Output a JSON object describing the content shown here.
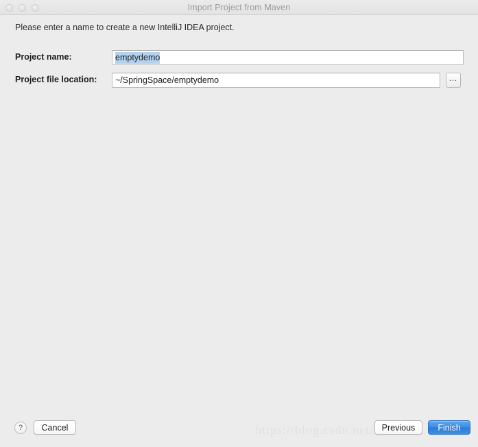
{
  "window": {
    "title": "Import Project from Maven",
    "traffic_lights": [
      "close",
      "minimize",
      "maximize"
    ]
  },
  "content": {
    "intro_text": "Please enter a name to create a new IntelliJ IDEA project."
  },
  "fields": {
    "project_name": {
      "label": "Project name:",
      "value": "emptydemo",
      "selected": true
    },
    "project_file_location": {
      "label": "Project file location:",
      "value": "~/SpringSpace/emptydemo",
      "browse_label": "..."
    }
  },
  "buttons": {
    "help": "?",
    "cancel": "Cancel",
    "previous": "Previous",
    "finish": "Finish"
  },
  "watermark": {
    "text": "https://blog.csdn.net/"
  },
  "colors": {
    "background": "#ececec",
    "titlebar": "#e8e8e8",
    "selection": "#b4d2f0",
    "primary_button": "#3d8ce0",
    "text": "#1d1d1d",
    "title_text": "#9a9a9a"
  }
}
